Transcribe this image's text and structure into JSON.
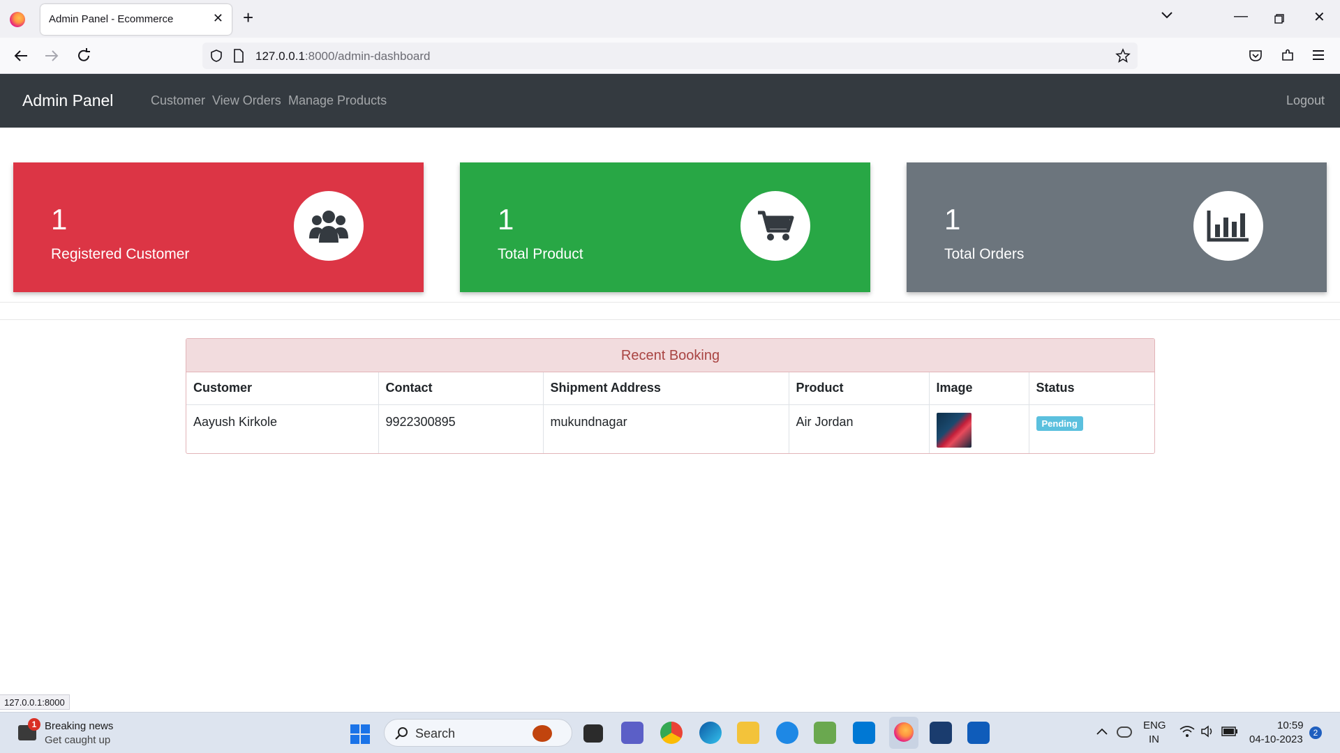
{
  "browser": {
    "tab_title": "Admin Panel - Ecommerce",
    "url_host": "127.0.0.1",
    "url_path": ":8000/admin-dashboard",
    "status_url": "127.0.0.1:8000"
  },
  "nav": {
    "brand": "Admin Panel",
    "links": [
      "Customer",
      "View Orders",
      "Manage Products"
    ],
    "logout": "Logout"
  },
  "cards": [
    {
      "value": "1",
      "label": "Registered Customer",
      "color": "#dc3545",
      "icon": "users-icon"
    },
    {
      "value": "1",
      "label": "Total Product",
      "color": "#28a745",
      "icon": "cart-icon"
    },
    {
      "value": "1",
      "label": "Total Orders",
      "color": "#6c757d",
      "icon": "bar-chart-icon"
    }
  ],
  "booking": {
    "title": "Recent Booking",
    "columns": [
      "Customer",
      "Contact",
      "Shipment Address",
      "Product",
      "Image",
      "Status"
    ],
    "rows": [
      {
        "customer": "Aayush Kirkole",
        "contact": "9922300895",
        "address": "mukundnagar",
        "product": "Air Jordan",
        "status": "Pending"
      }
    ]
  },
  "taskbar": {
    "news_badge": "1",
    "news_title": "Breaking news",
    "news_sub": "Get caught up",
    "search": "Search",
    "lang": "ENG",
    "region": "IN",
    "time": "10:59",
    "date": "04-10-2023",
    "notif_count": "2"
  }
}
